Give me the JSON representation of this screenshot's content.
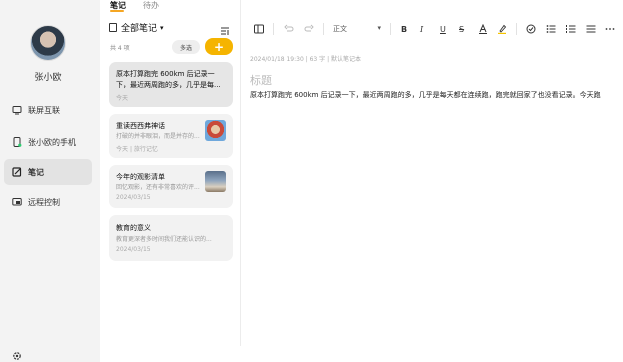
{
  "sidebar": {
    "username": "张小欧",
    "items": [
      {
        "label": "联屏互联",
        "icon": "screen-link-icon"
      },
      {
        "label": "张小欧的手机",
        "icon": "phone-icon"
      },
      {
        "label": "笔记",
        "icon": "notes-icon"
      },
      {
        "label": "远程控制",
        "icon": "remote-control-icon"
      }
    ],
    "settings_icon": "gear-icon"
  },
  "tabs": [
    {
      "label": "笔记",
      "active": true
    },
    {
      "label": "待办",
      "active": false
    }
  ],
  "notes_list": {
    "folder_label": "全部笔记",
    "count_label": "共 4 项",
    "multi_select_label": "多选",
    "add_label": "+",
    "notes": [
      {
        "title_line1": "原本打算跑完 600km 后记录一",
        "title_line2": "下，最近两周跑的多，几乎是每...",
        "date": "今天"
      },
      {
        "title_line1": "重读西西弗神话",
        "excerpt": "打破的并非眼泪，而是并存的...",
        "date": "今天",
        "tag": "旅行记忆"
      },
      {
        "title_line1": "今年的观影清单",
        "excerpt": "回忆观影，还有非常喜欢的评...",
        "date": "2024/03/15"
      },
      {
        "title_line1": "教育的意义",
        "excerpt": "教育更深者多时间我们还能认识的...",
        "date": "2024/03/15"
      }
    ]
  },
  "editor": {
    "font_name": "正文",
    "meta": "2024/01/18 19:30  |  63 字  |  默认笔记本",
    "title_placeholder": "标题",
    "body": "原本打算跑完 600km 后记录一下，最近两周跑的多，几乎是每天都在连续跑，跑完就回家了也没看记录。今天跑"
  },
  "colors": {
    "accent": "#f5b400",
    "tab_underline": "#f5a623"
  }
}
